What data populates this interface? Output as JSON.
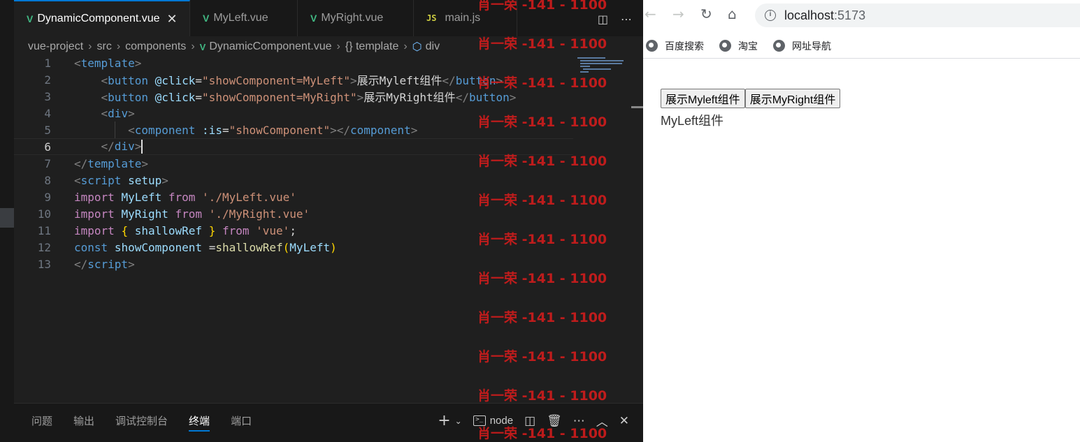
{
  "editor": {
    "tabs": [
      {
        "label": "DynamicComponent.vue",
        "icon": "vue-icon",
        "active": true
      },
      {
        "label": "MyLeft.vue",
        "icon": "vue-icon",
        "active": false
      },
      {
        "label": "MyRight.vue",
        "icon": "vue-icon",
        "active": false
      },
      {
        "label": "main.js",
        "icon": "js-icon",
        "active": false
      }
    ],
    "breadcrumb": [
      "vue-project",
      "src",
      "components",
      "DynamicComponent.vue",
      "{} template",
      "div"
    ],
    "lines": [
      {
        "n": "1"
      },
      {
        "n": "2"
      },
      {
        "n": "3"
      },
      {
        "n": "4"
      },
      {
        "n": "5"
      },
      {
        "n": "6"
      },
      {
        "n": "7"
      },
      {
        "n": "8"
      },
      {
        "n": "9"
      },
      {
        "n": "10"
      },
      {
        "n": "11"
      },
      {
        "n": "12"
      },
      {
        "n": "13"
      }
    ],
    "code": {
      "template_tag": "template",
      "button_tag": "button",
      "click_attr": "@click",
      "btn1_value": "\"showComponent=MyLeft\"",
      "btn1_text": "展示Myleft组件",
      "btn2_value": "\"showComponent=MyRight\"",
      "btn2_text": "展示MyRight组件",
      "div_tag": "div",
      "component_tag": "component",
      "is_attr": ":is",
      "is_value": "\"showComponent\"",
      "script_tag": "script",
      "setup_attr": "setup",
      "kw_import": "import",
      "kw_from": "from",
      "kw_const": "const",
      "my_left": "MyLeft",
      "my_right": "MyRight",
      "path_left": "'./MyLeft.vue'",
      "path_right": "'./MyRight.vue'",
      "shallow_ref": "shallowRef",
      "vue_str": "'vue'",
      "show_component": "showComponent"
    },
    "panel_tabs": [
      "问题",
      "输出",
      "调试控制台",
      "终端",
      "端口"
    ],
    "panel_active": "终端",
    "terminal_name": "node"
  },
  "watermark_text": "肖一荣 -141 - 1100",
  "browser": {
    "url_host": "localhost",
    "url_port": ":5173",
    "bookmarks": [
      "百度搜索",
      "淘宝",
      "网址导航"
    ],
    "buttons": [
      "展示Myleft组件",
      "展示MyRight组件"
    ],
    "rendered_text": "MyLeft组件"
  },
  "colors": {
    "vue_green": "#41b883",
    "accent_blue": "#0078d4",
    "watermark_red": "#cd1c1c"
  }
}
